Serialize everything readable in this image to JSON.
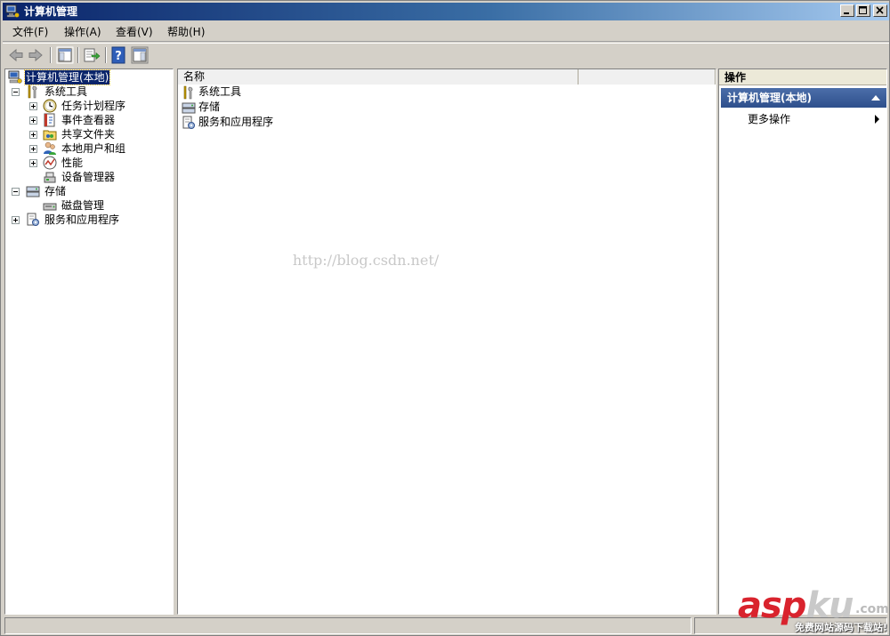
{
  "window": {
    "title": "计算机管理"
  },
  "menu": {
    "items": [
      "文件(F)",
      "操作(A)",
      "查看(V)",
      "帮助(H)"
    ]
  },
  "toolbar": {
    "buttons": [
      "back-arrow-icon",
      "forward-arrow-icon",
      "show-hide-tree-icon",
      "export-list-icon",
      "help-icon",
      "show-hide-action-pane-icon"
    ]
  },
  "tree": {
    "root": "计算机管理(本地)",
    "system_tools": "系统工具",
    "task_scheduler": "任务计划程序",
    "event_viewer": "事件查看器",
    "shared_folders": "共享文件夹",
    "local_users": "本地用户和组",
    "performance": "性能",
    "device_manager": "设备管理器",
    "storage": "存储",
    "disk_management": "磁盘管理",
    "services_apps": "服务和应用程序"
  },
  "list": {
    "column_name": "名称",
    "items": [
      "系统工具",
      "存储",
      "服务和应用程序"
    ]
  },
  "watermark": "http://blog.csdn.net/",
  "actions": {
    "title": "操作",
    "section": "计算机管理(本地)",
    "more": "更多操作"
  },
  "logo": {
    "asp": "asp",
    "ku": "ku",
    "com": ".com",
    "sub": "免费网站源码下载站!"
  }
}
